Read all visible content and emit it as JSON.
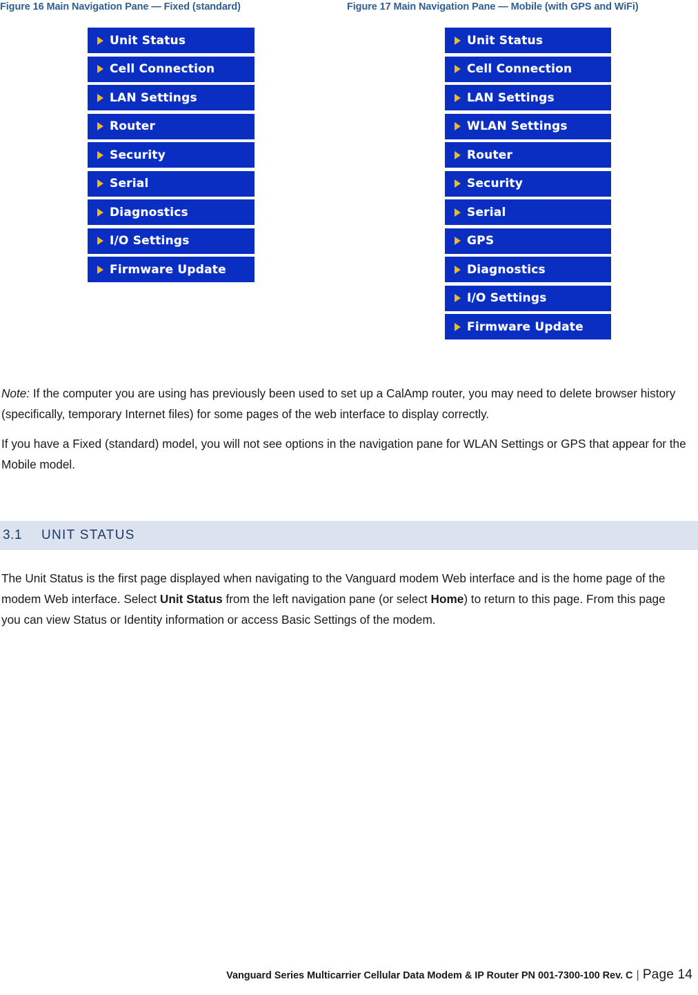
{
  "figures": {
    "left": {
      "caption": "Figure 16 Main Navigation Pane — Fixed (standard)",
      "items": [
        {
          "label": "Unit Status"
        },
        {
          "label": "Cell Connection"
        },
        {
          "label": "LAN Settings"
        },
        {
          "label": "Router"
        },
        {
          "label": "Security"
        },
        {
          "label": "Serial"
        },
        {
          "label": "Diagnostics"
        },
        {
          "label": "I/O Settings"
        },
        {
          "label": "Firmware Update"
        }
      ]
    },
    "right": {
      "caption": "Figure 17 Main Navigation Pane — Mobile (with GPS and WiFi)",
      "items": [
        {
          "label": "Unit Status"
        },
        {
          "label": "Cell Connection"
        },
        {
          "label": "LAN Settings"
        },
        {
          "label": "WLAN Settings"
        },
        {
          "label": "Router"
        },
        {
          "label": "Security"
        },
        {
          "label": "Serial"
        },
        {
          "label": "GPS"
        },
        {
          "label": "Diagnostics"
        },
        {
          "label": "I/O Settings"
        },
        {
          "label": "Firmware Update"
        }
      ]
    }
  },
  "body": {
    "note_label": "Note:",
    "note_text": " If the computer you are using has previously been used to set up a CalAmp router, you may need to delete browser history (specifically, temporary Internet files) for some pages of the web interface to display correctly.",
    "fixed_model_paragraph": "If you have a Fixed (standard) model, you will not see options in the navigation pane for WLAN Settings or GPS that appear for the Mobile model.",
    "unit_status_part1": "The Unit Status is the first page displayed when navigating to the Vanguard modem Web interface and is the home page of the modem Web interface. Select ",
    "unit_status_bold1": "Unit Status",
    "unit_status_part2": " from the left navigation pane (or select ",
    "unit_status_bold2": "Home",
    "unit_status_part3": ") to return to this page. From this page you can view Status or Identity information or access Basic Settings of the modem."
  },
  "section": {
    "number": "3.1",
    "title": "UNIT STATUS"
  },
  "footer": {
    "document": "Vanguard Series Multicarrier Cellular Data Modem & IP Router PN 001-7300-100 Rev. C",
    "separator": "|",
    "page": "Page 14"
  },
  "colors": {
    "caption_blue": "#2f5f8f",
    "nav_background": "#0a2ec2",
    "nav_text": "#ffffff",
    "nav_arrow": "#f5b81c",
    "heading_band": "#dbe3f0",
    "heading_text": "#1f3864"
  }
}
